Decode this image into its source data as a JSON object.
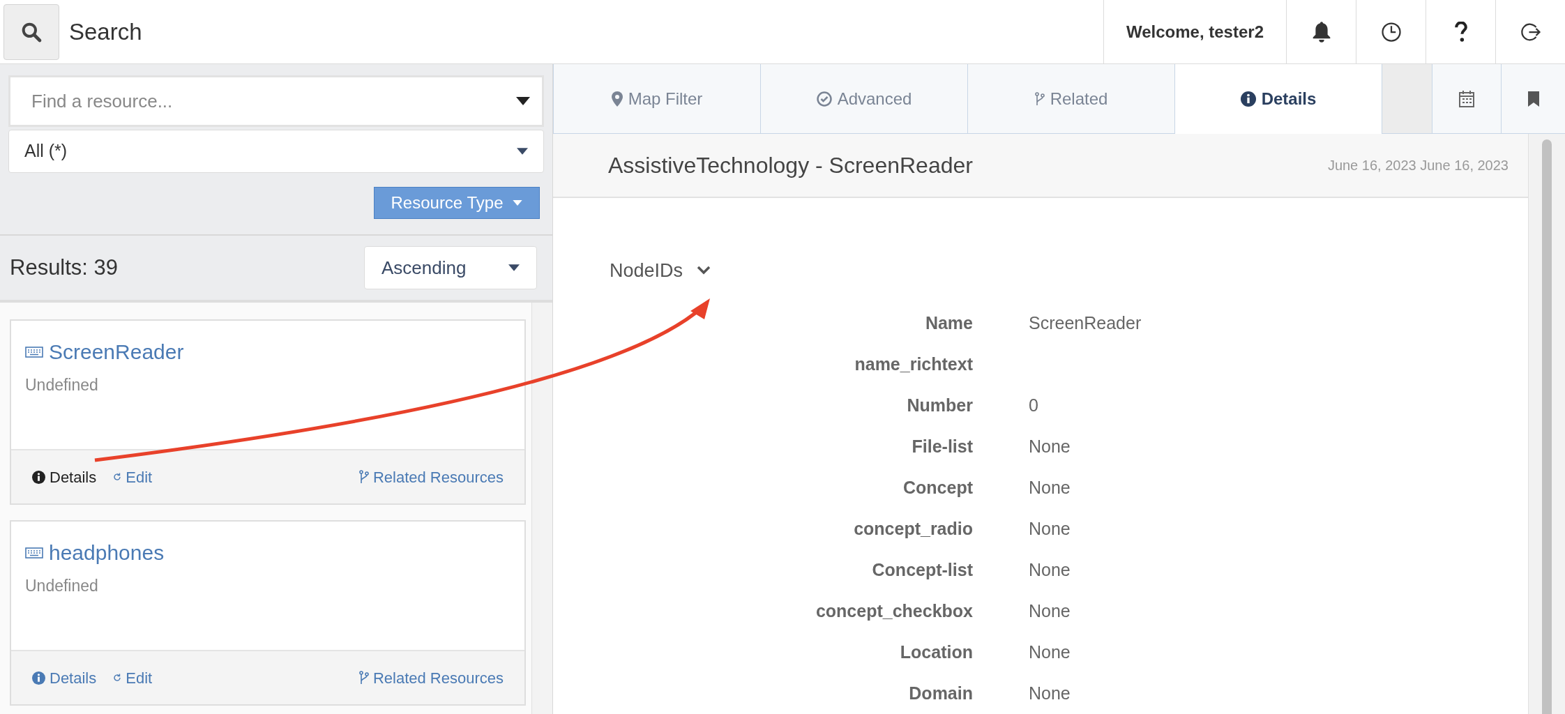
{
  "topbar": {
    "search_label": "Search",
    "welcome": "Welcome, tester2"
  },
  "filters": {
    "find_placeholder": "Find a resource...",
    "type_value": "All (*)",
    "resource_type_button": "Resource Type"
  },
  "results": {
    "count": "Results: 39",
    "sort": "Ascending"
  },
  "cards": [
    {
      "title": "ScreenReader",
      "subtitle": "Undefined",
      "details": "Details",
      "details_active": true,
      "edit": "Edit",
      "related": "Related Resources"
    },
    {
      "title": "headphones",
      "subtitle": "Undefined",
      "details": "Details",
      "details_active": false,
      "edit": "Edit",
      "related": "Related Resources"
    }
  ],
  "tabs": [
    {
      "label": "Map Filter",
      "kind": "map",
      "selected": false
    },
    {
      "label": "Advanced",
      "kind": "advanced",
      "selected": false
    },
    {
      "label": "Related",
      "kind": "related",
      "selected": false
    },
    {
      "label": "Details",
      "kind": "details",
      "selected": true
    }
  ],
  "report": {
    "title": "AssistiveTechnology - ScreenReader",
    "dates": "June 16, 2023 June 16, 2023",
    "section": "NodeIDs",
    "expanded": true,
    "fields": [
      {
        "label": "Name",
        "value": "ScreenReader"
      },
      {
        "label": "name_richtext"
      },
      {
        "label": "Number",
        "value": "0"
      },
      {
        "label": "File-list",
        "value": "None"
      },
      {
        "label": "Concept",
        "value": "None"
      },
      {
        "label": "concept_radio",
        "value": "None"
      },
      {
        "label": "Concept-list",
        "value": "None"
      },
      {
        "label": "concept_checkbox",
        "value": "None"
      },
      {
        "label": "Location",
        "value": "None"
      },
      {
        "label": "Domain",
        "value": "None"
      }
    ]
  }
}
